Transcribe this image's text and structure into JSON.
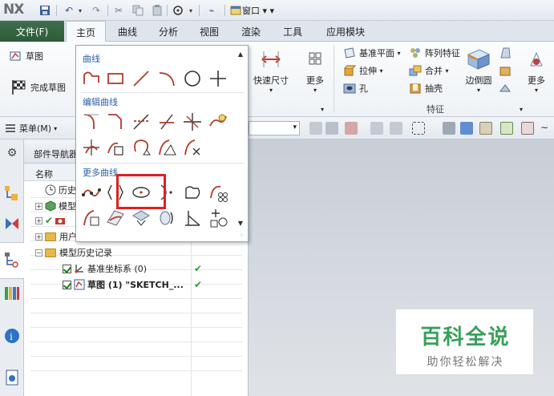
{
  "app": {
    "logo": "NX",
    "window_menu": "窗口"
  },
  "tabs": {
    "file": "文件(F)",
    "items": [
      "主页",
      "曲线",
      "分析",
      "视图",
      "渲染",
      "工具",
      "应用模块"
    ],
    "active": "主页"
  },
  "ribbon": {
    "sketch": "草图",
    "finish_sketch": "完成草图",
    "quick_dim": "快速尺寸",
    "more_1": "更多",
    "datum_plane": "基准平面",
    "extrude": "拉伸",
    "hole": "孔",
    "pattern_feature": "阵列特征",
    "unite": "合并",
    "shell": "抽壳",
    "edge_blend": "边倒圆",
    "more_2": "更多",
    "feature_group": "特征"
  },
  "toolbar": {
    "menu": "菜单(M)"
  },
  "gallery": {
    "section_curve": "曲线",
    "section_edit": "编辑曲线",
    "section_more": "更多曲线",
    "colors": {
      "accent": "#e02020",
      "icon_red": "#b23a2a",
      "section": "#2d5fa6"
    }
  },
  "navigator": {
    "title": "部件导航器",
    "col_name": "名称",
    "rows": [
      {
        "label": "历史",
        "icon": "clock-icon"
      },
      {
        "label": "模型",
        "icon": "model-views-icon"
      },
      {
        "label": "",
        "icon": "camera-icon"
      },
      {
        "label": "用户",
        "icon": "folder-icon"
      },
      {
        "label": "模型历史记录",
        "icon": "folder-icon"
      },
      {
        "label": "基准坐标系 (0)",
        "icon": "csys-icon",
        "status": "✔"
      },
      {
        "label": "草图 (1) \"SKETCH_...",
        "icon": "sketch-icon",
        "status": "✔"
      }
    ]
  },
  "watermark": {
    "title": "百科全说",
    "subtitle": "助你轻松解决"
  }
}
